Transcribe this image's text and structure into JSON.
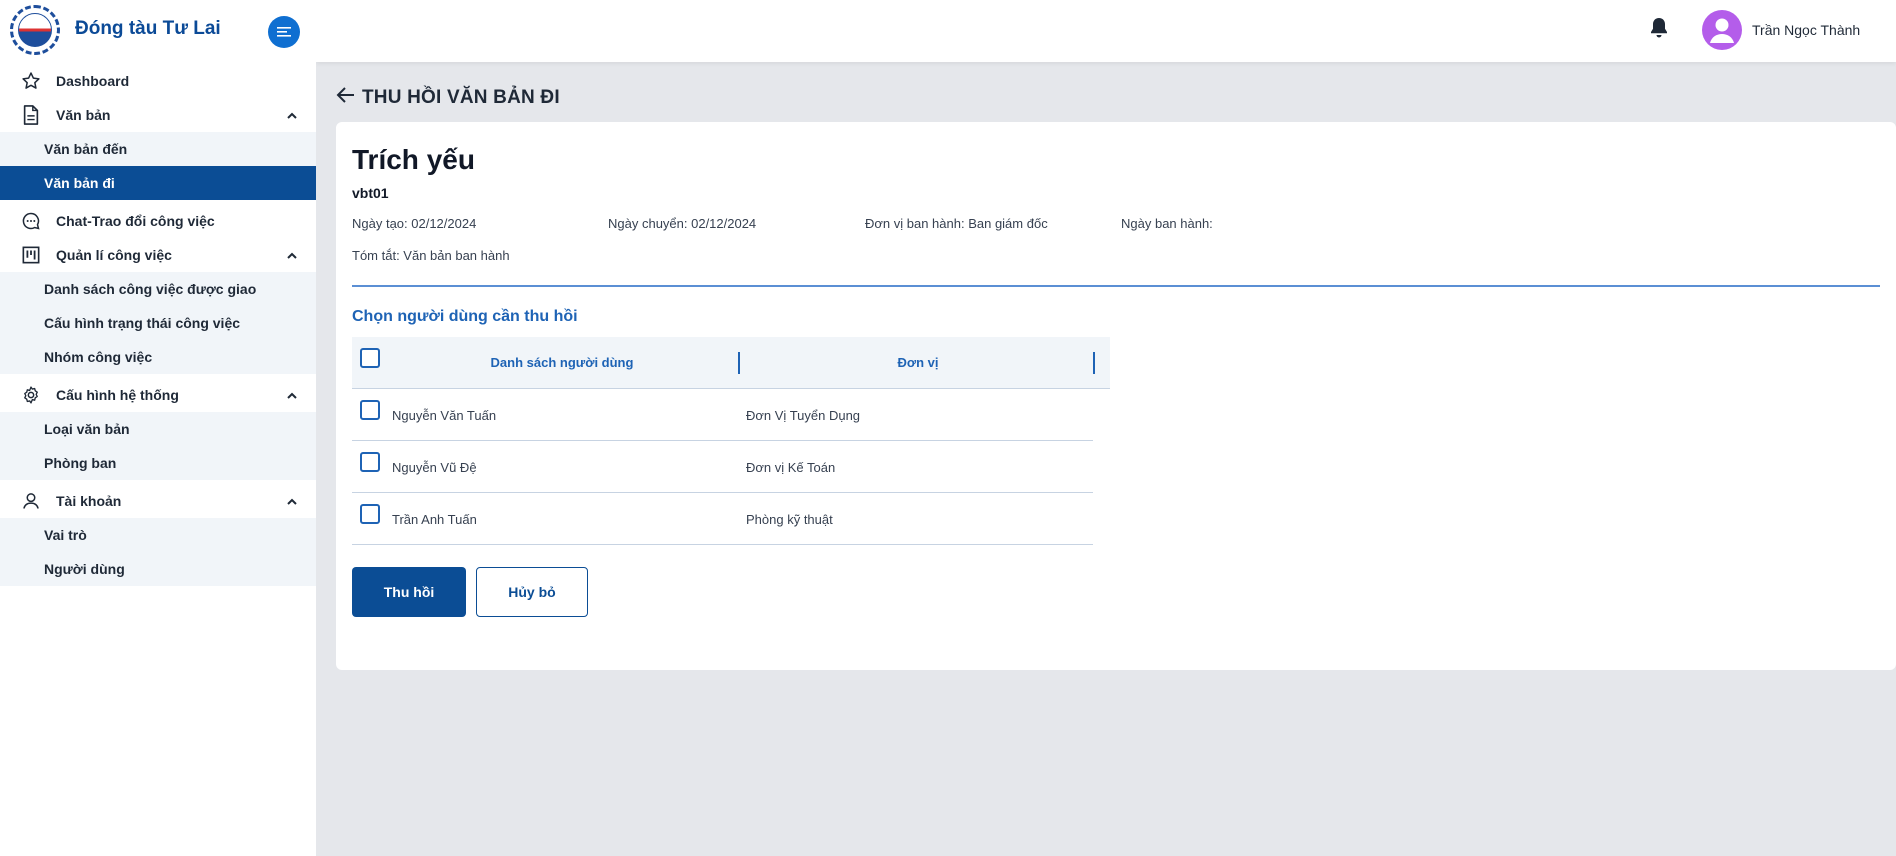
{
  "brand": {
    "name": "Đóng tàu Tư Lai",
    "logo_icon": "company-logo"
  },
  "sidebar": {
    "dashboard": "Dashboard",
    "van_ban": {
      "label": "Văn bản",
      "items": [
        "Văn bản đến",
        "Văn bản đi"
      ],
      "active": "Văn bản đi"
    },
    "chat": "Chat-Trao đổi công việc",
    "quan_li": {
      "label": "Quản lí công việc",
      "items": [
        "Danh sách công việc được giao",
        "Cấu hình trạng thái công việc",
        "Nhóm công việc"
      ]
    },
    "cau_hinh": {
      "label": "Cấu hình hệ thống",
      "items": [
        "Loại văn bản",
        "Phòng ban"
      ]
    },
    "tai_khoan": {
      "label": "Tài khoản",
      "items": [
        "Vai trò",
        "Người dùng"
      ]
    }
  },
  "topbar": {
    "username": "Trần Ngọc Thành"
  },
  "page": {
    "title": "THU HỒI VĂN BẢN ĐI"
  },
  "document": {
    "heading": "Trích yếu",
    "code": "vbt01",
    "created": "Ngày tạo: 02/12/2024",
    "transferred": "Ngày chuyển: 02/12/2024",
    "issuer": "Đơn vị ban hành: Ban giám đốc",
    "issued_date": "Ngày ban hành:",
    "summary": "Tóm tắt: Văn bản ban hành"
  },
  "recall": {
    "section_title": "Chọn người dùng cần thu hồi",
    "columns": [
      "Danh sách người dùng",
      "Đơn vị"
    ],
    "rows": [
      {
        "name": "Nguyễn Văn Tuấn",
        "unit": "Đơn Vị Tuyển Dụng",
        "checked": false
      },
      {
        "name": "Nguyễn Vũ Đệ",
        "unit": "Đơn vị Kế Toán",
        "checked": false
      },
      {
        "name": "Trần Anh Tuấn",
        "unit": "Phòng kỹ thuật",
        "checked": false
      }
    ]
  },
  "actions": {
    "confirm": "Thu hồi",
    "cancel": "Hủy bỏ"
  },
  "colors": {
    "primary": "#0b4d95",
    "accent": "#1e63b5",
    "avatar": "#b45dea"
  }
}
